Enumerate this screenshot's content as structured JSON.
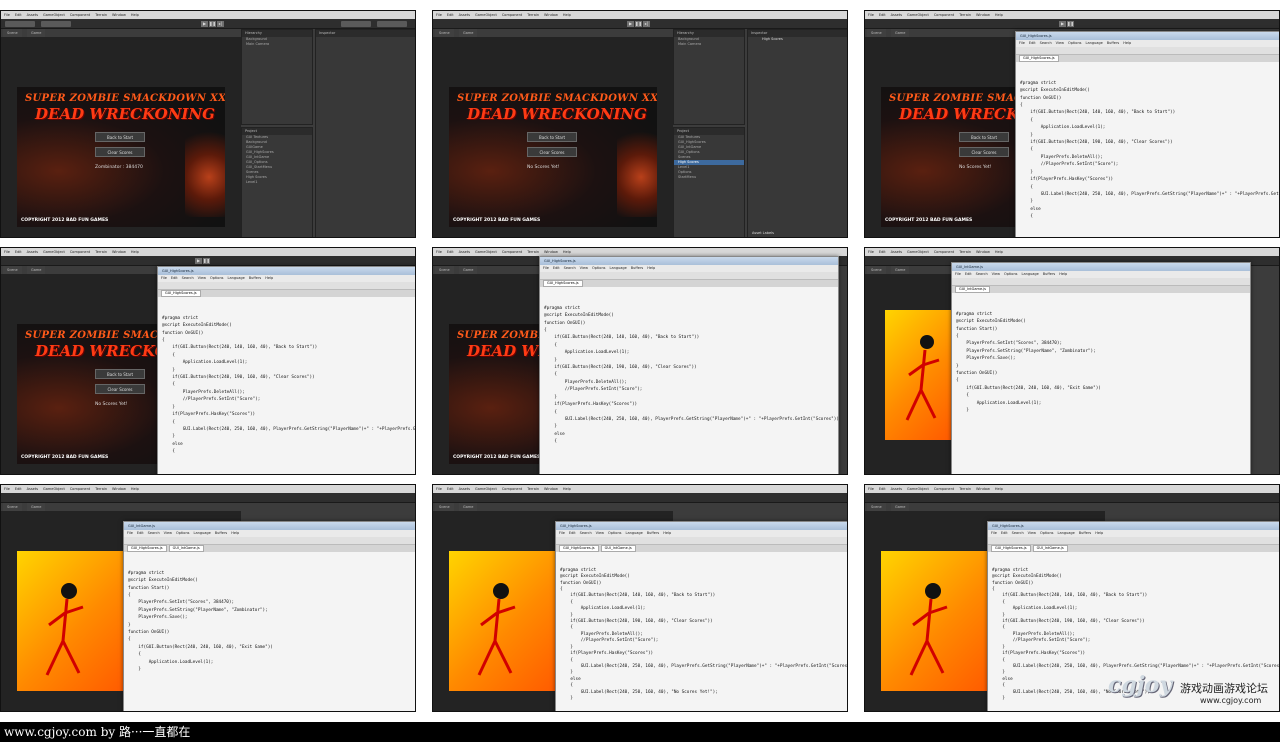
{
  "unity_menu": [
    "File",
    "Edit",
    "Assets",
    "GameObject",
    "Component",
    "Terrain",
    "Window",
    "Help"
  ],
  "tabs": {
    "scene": "Scene",
    "game": "Game",
    "hierarchy": "Hierarchy",
    "inspector": "Inspector",
    "project": "Project"
  },
  "game_screen": {
    "title_line1": "SUPER ZOMBIE SMACKDOWN XX",
    "title_line2": "DEAD WRECKONING",
    "back_button": "Back to Start",
    "clear_button": "Clear Scores",
    "score_text": "Zombinator : 384470",
    "no_scores_text": "No Scores Yet!",
    "copyright": "COPYRIGHT 2012 BAD FUN GAMES"
  },
  "hierarchy_items": [
    "Background",
    "Main Camera"
  ],
  "project_items": [
    "GUI Textures",
    "Background",
    "GUIGame",
    "GUI_HighScores",
    "GUI_IntGame",
    "GUI_Options",
    "GUI_StartMenu",
    "Scenes",
    "High Scores",
    "Level1",
    "Options",
    "StartMenu"
  ],
  "asset_labels": "Asset Labels",
  "inspector_item": "High Scores",
  "editor": {
    "menu": [
      "File",
      "Edit",
      "Search",
      "View",
      "Options",
      "Language",
      "Buffers",
      "Help"
    ],
    "tab_highscores": "GUI_HighScores.js",
    "tab_intgame": "GUI_IntGame.js"
  },
  "code_highscores": [
    "#pragma strict",
    "@script ExecuteInEditMode()",
    "",
    "function OnGUI()",
    "{",
    "    if(GUI.Button(Rect(240, 140, 160, 40), \"Back to Start\"))",
    "    {",
    "        Application.LoadLevel(1);",
    "    }",
    "    if(GUI.Button(Rect(240, 190, 160, 40), \"Clear Scores\"))",
    "    {",
    "        PlayerPrefs.DeleteAll();",
    "        //PlayerPrefs.SetInt(\"Score\");",
    "    }",
    "",
    "    if(PlayerPrefs.HasKey(\"Scores\"))",
    "    {",
    "        GUI.Label(Rect(240, 250, 160, 40), PlayerPrefs.GetString(\"PlayerName\")+\" : \"+PlayerPrefs.GetInt(\"Scores\"));",
    "    }",
    "    else",
    "    {",
    "        GUI.Label(Rect(240, 250, 160, 40), \"No Scores Yet!\");",
    "    }",
    "}"
  ],
  "code_intgame": [
    "#pragma strict",
    "@script ExecuteInEditMode()",
    "",
    "function Start()",
    "{",
    "    PlayerPrefs.SetInt(\"Scores\", 384470);",
    "    PlayerPrefs.SetString(\"PlayerName\", \"Zombinator\");",
    "    PlayerPrefs.Save();",
    "}",
    "",
    "function OnGUI()",
    "{",
    "    if(GUI.Button(Rect(240, 240, 160, 40), \"Exit Game\"))",
    "    {",
    "        Application.LoadLevel(1);",
    "    }",
    "}"
  ],
  "watermark": {
    "bottom": "www.cgjoy.com by 路···一直都在",
    "logo": "cgjoy",
    "chinese": "游戏动画游戏论坛",
    "url": "www.cgjoy.com"
  },
  "colors": {
    "unity_bg": "#3c3c3c",
    "editor_bg": "#f4f4f4",
    "title_red": "#ff3b14",
    "orange": "#ff8a00"
  }
}
